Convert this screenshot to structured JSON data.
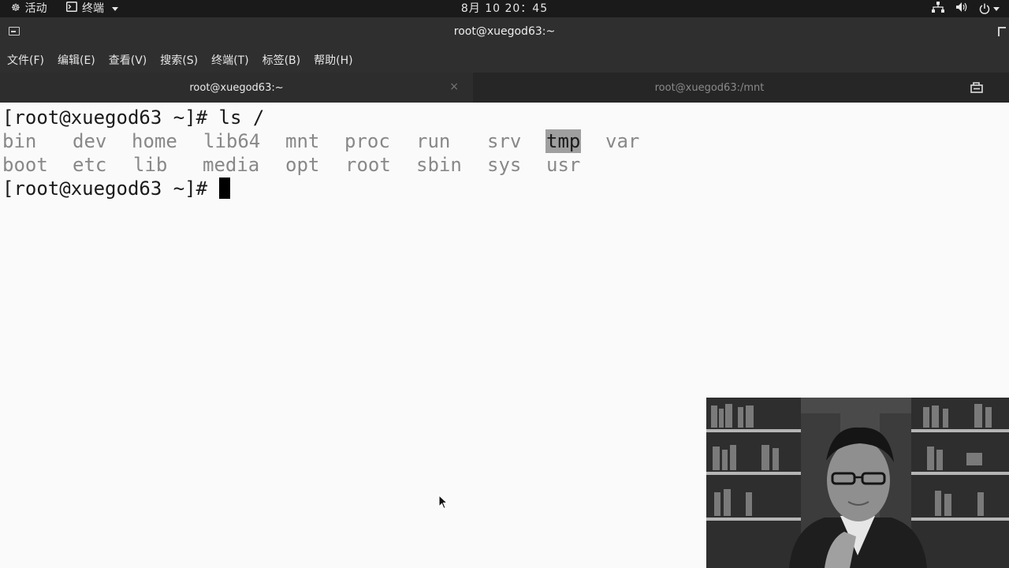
{
  "topbar": {
    "activities": "活动",
    "app_menu": "终端",
    "clock": "8月 10 20：45"
  },
  "window": {
    "title": "root@xuegod63:~"
  },
  "menubar": {
    "items": [
      "文件(F)",
      "编辑(E)",
      "查看(V)",
      "搜索(S)",
      "终端(T)",
      "标签(B)",
      "帮助(H)"
    ]
  },
  "tabs": [
    {
      "label": "root@xuegod63:~",
      "close": "×"
    },
    {
      "label": "root@xuegod63:/mnt"
    }
  ],
  "terminal": {
    "prompt": "[root@xuegod63 ~]# ",
    "command": "ls /",
    "ls_row1": [
      "bin",
      "dev",
      "home",
      "lib64",
      "mnt",
      "proc",
      "run",
      "srv",
      "tmp",
      "var"
    ],
    "ls_row2": [
      "boot",
      "etc",
      "lib",
      "media",
      "opt",
      "root",
      "sbin",
      "sys",
      "usr"
    ],
    "highlighted": "tmp"
  },
  "colors": {
    "topbar_bg": "#1a1a1a",
    "titlebar_bg": "#2f2f2f",
    "terminal_bg": "#fafafa",
    "ls_text": "#888888",
    "highlight_bg": "#9f9f9f"
  }
}
